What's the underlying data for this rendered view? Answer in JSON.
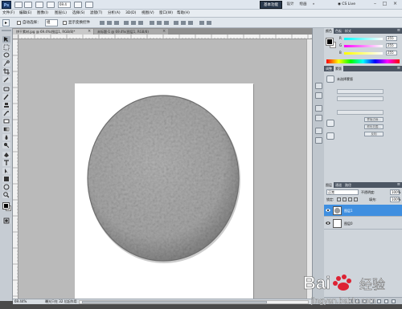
{
  "titlebar": {
    "logo": "Ps",
    "zoom": "69.4",
    "workspaces": [
      "基本功能",
      "设计",
      "绘画",
      "»"
    ],
    "cs_live": "CS Live"
  },
  "menu": [
    "文件(F)",
    "编辑(E)",
    "图像(I)",
    "图层(L)",
    "选择(S)",
    "滤镜(T)",
    "分析(A)",
    "3D(D)",
    "视图(V)",
    "窗口(W)",
    "帮助(H)"
  ],
  "options": {
    "auto_select": "自动选择：",
    "auto_select_value": "组",
    "show_transform": "显示变换控件"
  },
  "tabs": [
    {
      "label": "饼干素材.jpg @ 69.4%(图层1, RGB/8)*"
    },
    {
      "label": "未标题-1 @ 69.4%(图层1, RGB/8)"
    }
  ],
  "status": {
    "zoom": "69.44%",
    "info": "曝光只在 32 位起作用"
  },
  "color_panel": {
    "tabs": [
      "颜色",
      "色板",
      "样式"
    ],
    "sliders": [
      {
        "label": "R",
        "value": "255",
        "gradient": "linear-gradient(to right,#00ffff,#ffffff)"
      },
      {
        "label": "G",
        "value": "255",
        "gradient": "linear-gradient(to right,#ff00ff,#ffffff)"
      },
      {
        "label": "B",
        "value": "255",
        "gradient": "linear-gradient(to right,#ffff00,#ffffff)"
      }
    ]
  },
  "adjustments_panel": {
    "tabs": [
      "调整",
      "蒙版"
    ],
    "title": "未选择蒙版",
    "buttons": [
      "蒙版边缘...",
      "颜色范围...",
      "反相"
    ]
  },
  "layers_panel": {
    "tabs": [
      "图层",
      "通道",
      "路径"
    ],
    "blend_mode": "正常",
    "opacity_label": "不透明度:",
    "opacity": "100%",
    "lock_label": "锁定:",
    "fill_label": "填充:",
    "fill": "100%",
    "layers": [
      {
        "name": "图层1",
        "selected": true
      },
      {
        "name": "图层0",
        "selected": false
      }
    ]
  },
  "watermark": {
    "brand": "Bai",
    "brand_cn": "经验",
    "url": "jingyan.baidu.com"
  },
  "colors": {
    "canvas_bg": "#bababa",
    "selection": "#3f8fe0",
    "panel_header": "#4c5663",
    "workspace_active": "#2a3a4d"
  }
}
